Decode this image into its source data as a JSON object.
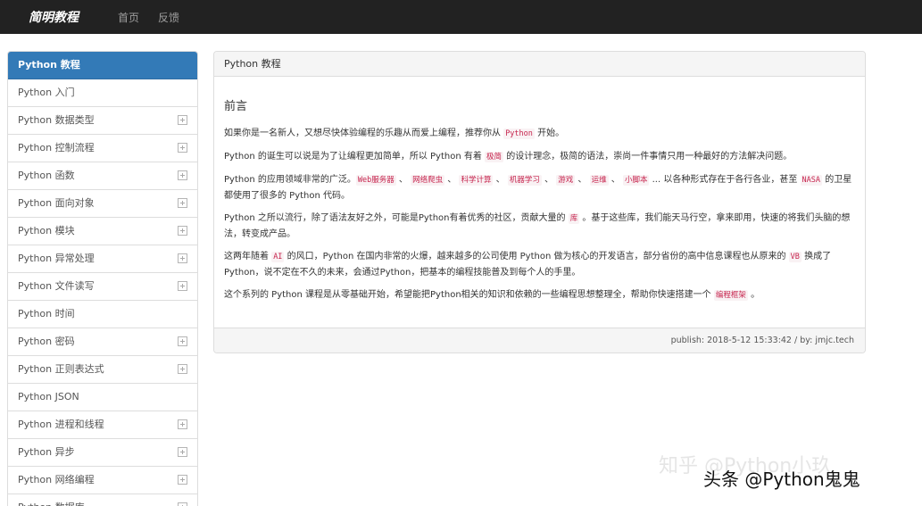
{
  "navbar": {
    "brand": "简明教程",
    "links": [
      "首页",
      "反馈"
    ]
  },
  "sidebar": {
    "items": [
      {
        "label": "Python 教程",
        "active": true,
        "expandable": false
      },
      {
        "label": "Python 入门",
        "active": false,
        "expandable": false
      },
      {
        "label": "Python 数据类型",
        "active": false,
        "expandable": true
      },
      {
        "label": "Python 控制流程",
        "active": false,
        "expandable": true
      },
      {
        "label": "Python 函数",
        "active": false,
        "expandable": true
      },
      {
        "label": "Python 面向对象",
        "active": false,
        "expandable": true
      },
      {
        "label": "Python 模块",
        "active": false,
        "expandable": true
      },
      {
        "label": "Python 异常处理",
        "active": false,
        "expandable": true
      },
      {
        "label": "Python 文件读写",
        "active": false,
        "expandable": true
      },
      {
        "label": "Python 时间",
        "active": false,
        "expandable": false
      },
      {
        "label": "Python 密码",
        "active": false,
        "expandable": true
      },
      {
        "label": "Python 正则表达式",
        "active": false,
        "expandable": true
      },
      {
        "label": "Python JSON",
        "active": false,
        "expandable": false
      },
      {
        "label": "Python 进程和线程",
        "active": false,
        "expandable": true
      },
      {
        "label": "Python 异步",
        "active": false,
        "expandable": true
      },
      {
        "label": "Python 网络编程",
        "active": false,
        "expandable": true
      },
      {
        "label": "Python 数据库",
        "active": false,
        "expandable": true
      }
    ]
  },
  "panel": {
    "heading": "Python 教程",
    "section_title": "前言",
    "paragraphs": [
      {
        "segments": [
          {
            "text": "如果你是一名新人，又想尽快体验编程的乐趣从而爱上编程，推荐你从 "
          },
          {
            "text": "Python",
            "code": true
          },
          {
            "text": " 开始。"
          }
        ]
      },
      {
        "segments": [
          {
            "text": "Python 的诞生可以说是为了让编程更加简单，所以 Python 有着 "
          },
          {
            "text": "极简",
            "code": true
          },
          {
            "text": " 的设计理念，极简的语法，崇尚一件事情只用一种最好的方法解决问题。"
          }
        ]
      },
      {
        "segments": [
          {
            "text": "Python 的应用领域非常的广泛。"
          },
          {
            "text": "Web服务器",
            "code": true
          },
          {
            "text": " 、 "
          },
          {
            "text": "网络爬虫",
            "code": true
          },
          {
            "text": " 、 "
          },
          {
            "text": "科学计算",
            "code": true
          },
          {
            "text": " 、 "
          },
          {
            "text": "机器学习",
            "code": true
          },
          {
            "text": " 、 "
          },
          {
            "text": "游戏",
            "code": true
          },
          {
            "text": " 、 "
          },
          {
            "text": "运维",
            "code": true
          },
          {
            "text": " 、 "
          },
          {
            "text": "小脚本",
            "code": true
          },
          {
            "text": " ... 以各种形式存在于各行各业，甚至 "
          },
          {
            "text": "NASA",
            "code": true
          },
          {
            "text": " 的卫星都使用了很多的 Python 代码。"
          }
        ]
      },
      {
        "segments": [
          {
            "text": "Python 之所以流行，除了语法友好之外，可能是Python有着优秀的社区，贡献大量的 "
          },
          {
            "text": "库",
            "code": true
          },
          {
            "text": " 。基于这些库，我们能天马行空，拿来即用，快速的将我们头脑的想法，转变成产品。"
          }
        ]
      },
      {
        "segments": [
          {
            "text": "这两年随着 "
          },
          {
            "text": "AI",
            "code": true
          },
          {
            "text": " 的风口，Python 在国内非常的火爆，越来越多的公司使用 Python 做为核心的开发语言，部分省份的高中信息课程也从原来的 "
          },
          {
            "text": "VB",
            "code": true
          },
          {
            "text": " 换成了 Python，说不定在不久的未来，会通过Python，把基本的编程技能普及到每个人的手里。"
          }
        ]
      },
      {
        "segments": [
          {
            "text": "这个系列的 Python 课程是从零基础开始，希望能把Python相关的知识和依赖的一些编程思想整理全，帮助你快速搭建一个 "
          },
          {
            "text": "编程框架",
            "code": true
          },
          {
            "text": " 。"
          }
        ]
      }
    ],
    "footer": "publish: 2018-5-12 15:33:42 / by: jmjc.tech"
  },
  "overlay": {
    "watermark": "知乎 @Python小玖",
    "credit": "头条 @Python鬼鬼"
  },
  "colors": {
    "navbar_bg": "#222222",
    "active_item": "#337ab7",
    "code_text": "#c7254e",
    "code_bg": "#f9f2f4"
  }
}
